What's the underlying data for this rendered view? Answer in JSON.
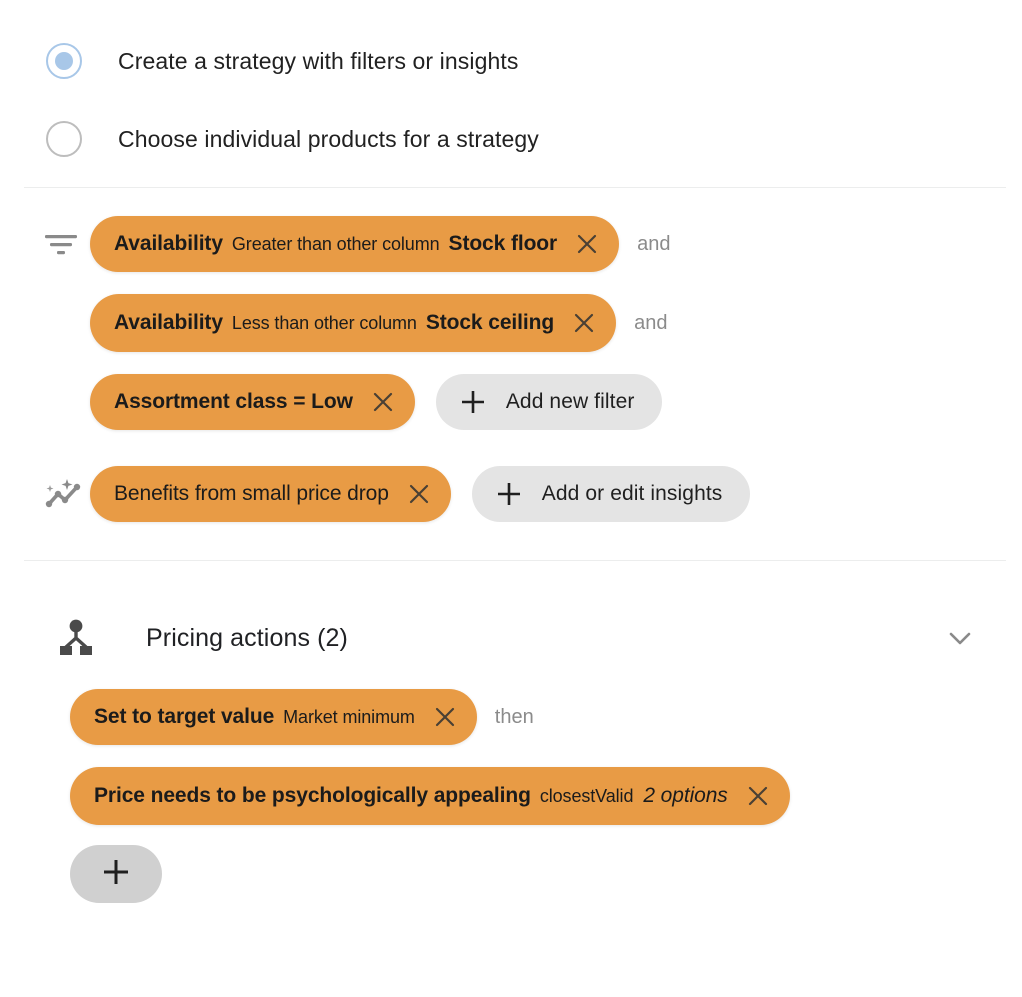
{
  "strategy_type": {
    "options": [
      {
        "label": "Create a strategy with filters or insights",
        "selected": true
      },
      {
        "label": "Choose individual products for a strategy",
        "selected": false
      }
    ]
  },
  "filters": {
    "icon": "filter-icon",
    "chips": [
      {
        "field": "Availability",
        "operator": "Greater than other column",
        "value": "Stock floor",
        "conjunction": "and"
      },
      {
        "field": "Availability",
        "operator": "Less than other column",
        "value": "Stock ceiling",
        "conjunction": "and"
      },
      {
        "field": "Assortment class = Low",
        "operator": "",
        "value": "",
        "conjunction": ""
      }
    ],
    "add_button": {
      "label": "Add new filter",
      "icon": "plus-icon"
    }
  },
  "insights": {
    "icon": "insights-icon",
    "chips": [
      {
        "label": "Benefits from small price drop"
      }
    ],
    "add_button": {
      "label": "Add or edit insights",
      "icon": "plus-icon"
    }
  },
  "pricing_actions": {
    "icon": "hierarchy-icon",
    "title": "Pricing actions (2)",
    "collapse_icon": "chevron-down-icon",
    "chips": [
      {
        "name": "Set to target value",
        "detail": "Market minimum",
        "extra": "",
        "conjunction": "then"
      },
      {
        "name": "Price needs to be psychologically appealing",
        "detail": "closestValid",
        "extra": "2 options",
        "conjunction": ""
      }
    ],
    "add_button": {
      "icon": "plus-icon"
    }
  },
  "colors": {
    "chip_orange": "#e89b45",
    "button_gray": "#e4e4e4",
    "plus_button_gray": "#d0d0d0",
    "radio_blue": "#a8c7e8",
    "divider": "#eceded",
    "muted_text": "#8b8b8b"
  }
}
